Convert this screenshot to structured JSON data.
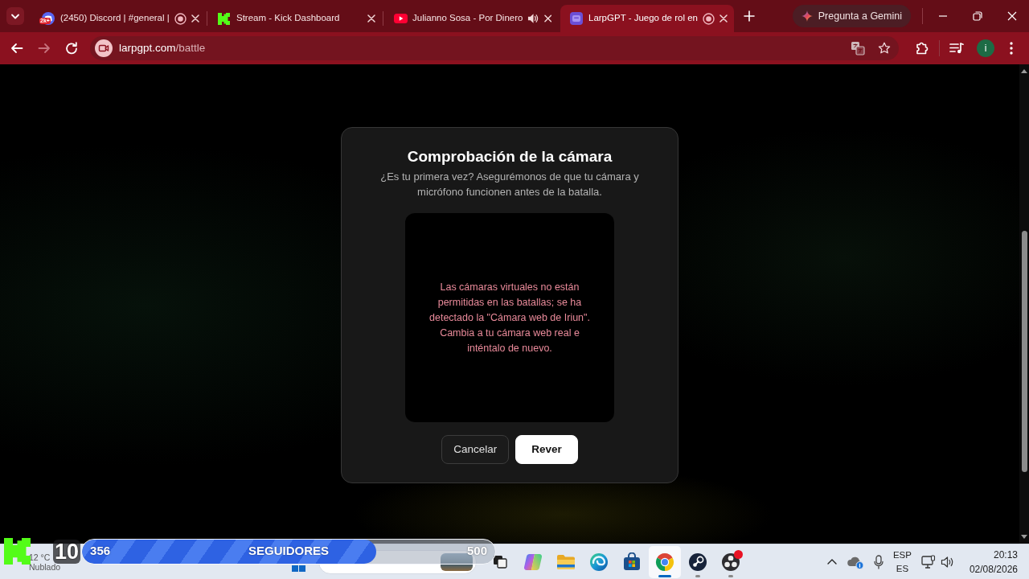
{
  "browser": {
    "tabs": [
      {
        "favicon": {
          "kind": "discord",
          "badge": "2k+"
        },
        "title": "(2450) Discord | #general |",
        "indicator": {
          "kind": "recording"
        },
        "selected": false
      },
      {
        "favicon": {
          "kind": "kick"
        },
        "title": "Stream - Kick Dashboard",
        "selected": false
      },
      {
        "favicon": {
          "kind": "youtube"
        },
        "title": "Julianno Sosa - Por Dinero",
        "indicator": {
          "kind": "audio"
        },
        "selected": false
      },
      {
        "favicon": {
          "kind": "larpgpt"
        },
        "title": "LarpGPT - Juego de rol en",
        "indicator": {
          "kind": "recording"
        },
        "selected": true
      }
    ],
    "gemini_button": "Pregunta a Gemini"
  },
  "toolbar": {
    "nav_buttons": [
      {
        "kind": "back",
        "disabled": false
      },
      {
        "kind": "forward",
        "disabled": true
      },
      {
        "kind": "reload",
        "disabled": false
      }
    ],
    "address": {
      "domain": "larpgpt.com",
      "path": "/battle"
    },
    "profile_initial": "i"
  },
  "dialog": {
    "title": "Comprobación de la cámara",
    "subtitle": "¿Es tu primera vez? Asegurémonos de que tu cámara y micrófono funcionen antes de la batalla.",
    "error_message": "Las cámaras virtuales no están permitidas en las batallas; se ha detectado la \"Cámara web de Iriun\". Cambia a tu cámara web real e inténtalo de nuevo.",
    "buttons": [
      {
        "kind": "secondary",
        "label": "Cancelar"
      },
      {
        "kind": "primary",
        "label": "Rever"
      }
    ]
  },
  "stream_overlay": {
    "count": "10",
    "follower_goal": {
      "current": "356",
      "label": "SEGUIDORES",
      "target": "500",
      "level": 0.712
    }
  },
  "taskbar": {
    "weather": {
      "temperature": "12 °C",
      "condition": "Nublado"
    },
    "apps": [
      {
        "kind": "copilot",
        "selected": false,
        "running": false,
        "notification": false
      },
      {
        "kind": "files",
        "selected": false,
        "running": false,
        "notification": false
      },
      {
        "kind": "edge",
        "selected": false,
        "running": false,
        "notification": false
      },
      {
        "kind": "store",
        "selected": false,
        "running": false,
        "notification": false
      },
      {
        "kind": "chrome",
        "selected": true,
        "running": true,
        "notification": false
      },
      {
        "kind": "steam",
        "selected": false,
        "running": true,
        "notification": false
      },
      {
        "kind": "obs",
        "selected": false,
        "running": true,
        "notification": true
      }
    ],
    "tray": {
      "input_language": "ESP",
      "keyboard_layout": "ES"
    },
    "clock": {
      "time": "20:13",
      "date": "02/08/2026"
    }
  }
}
